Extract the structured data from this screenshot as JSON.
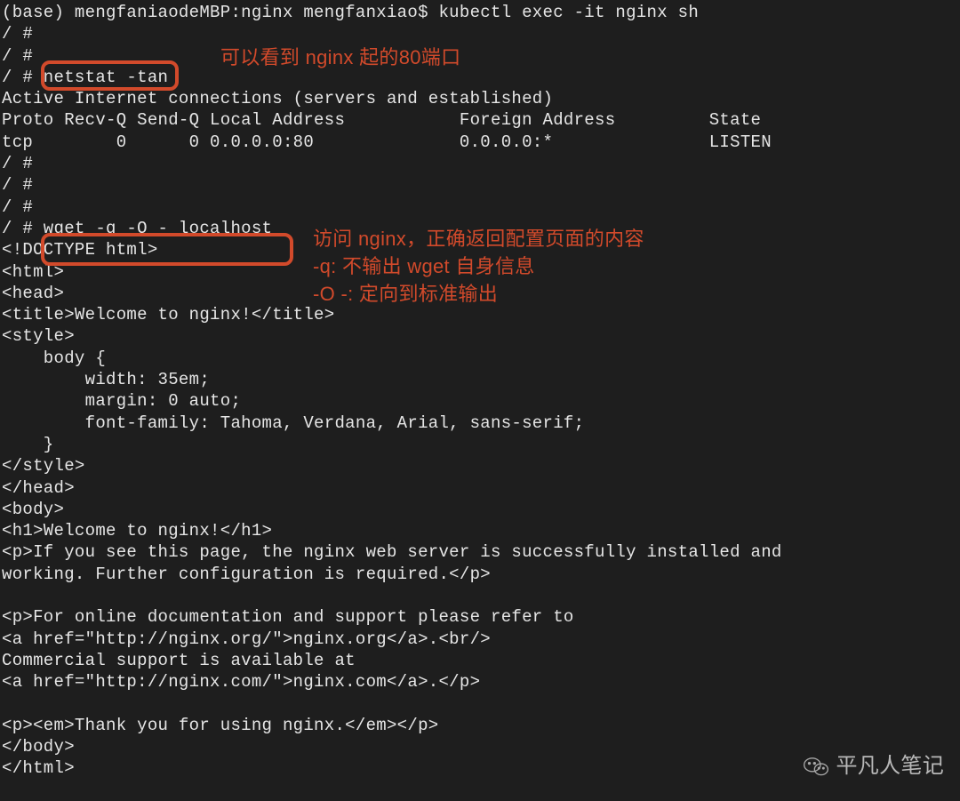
{
  "colors": {
    "bg": "#1e1e1e",
    "fg": "#e6e6e6",
    "highlight": "#d24a2b"
  },
  "terminal": {
    "lines": [
      "(base) mengfaniaodeMBP:nginx mengfanxiao$ kubectl exec -it nginx sh",
      "/ #",
      "/ #",
      "/ # netstat -tan",
      "Active Internet connections (servers and established)",
      "Proto Recv-Q Send-Q Local Address           Foreign Address         State",
      "tcp        0      0 0.0.0.0:80              0.0.0.0:*               LISTEN",
      "/ #",
      "/ #",
      "/ #",
      "/ # wget -q -O - localhost",
      "<!DOCTYPE html>",
      "<html>",
      "<head>",
      "<title>Welcome to nginx!</title>",
      "<style>",
      "    body {",
      "        width: 35em;",
      "        margin: 0 auto;",
      "        font-family: Tahoma, Verdana, Arial, sans-serif;",
      "    }",
      "</style>",
      "</head>",
      "<body>",
      "<h1>Welcome to nginx!</h1>",
      "<p>If you see this page, the nginx web server is successfully installed and",
      "working. Further configuration is required.</p>",
      "",
      "<p>For online documentation and support please refer to",
      "<a href=\"http://nginx.org/\">nginx.org</a>.<br/>",
      "Commercial support is available at",
      "<a href=\"http://nginx.com/\">nginx.com</a>.</p>",
      "",
      "<p><em>Thank you for using nginx.</em></p>",
      "</body>",
      "</html>"
    ]
  },
  "highlights": {
    "box1_cmd": "netstat -tan",
    "box2_cmd": "wget -q -O - localhost"
  },
  "annotations": {
    "a1": "可以看到 nginx 起的80端口",
    "a2_line1": "访问 nginx，正确返回配置页面的内容",
    "a2_line2": "-q: 不输出 wget 自身信息",
    "a2_line3": "-O -: 定向到标准输出"
  },
  "watermark": {
    "icon": "wechat-icon",
    "text": "平凡人笔记"
  }
}
